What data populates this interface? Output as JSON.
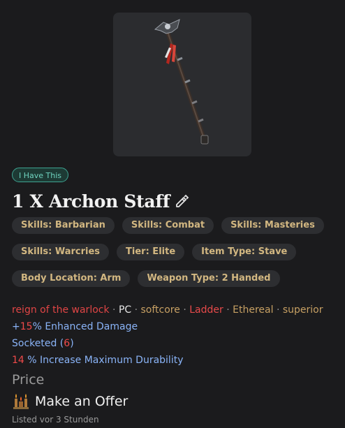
{
  "badge": {
    "label": "I Have This"
  },
  "item": {
    "title": "1 X Archon Staff",
    "image_icon": "archon-staff-icon",
    "edit_icon": "pencil-icon"
  },
  "tags": [
    [
      "Skills: Barbarian",
      "Skills: Combat",
      "Skills: Masteries"
    ],
    [
      "Skills: Warcries",
      "Tier: Elite",
      "Item Type: Stave"
    ],
    [
      "Body Location: Arm",
      "Weapon Type: 2 Handed"
    ]
  ],
  "meta": {
    "season": "reign of the warlock",
    "platform": "PC",
    "mode": "softcore",
    "ladder": "Ladder",
    "ethereal": "Ethereal",
    "quality": "superior",
    "separator": "·"
  },
  "stats": {
    "enhanced_damage_prefix": "+",
    "enhanced_damage_value": "15",
    "enhanced_damage_text": "% Enhanced Damage",
    "socketed_text": "Socketed (",
    "socketed_value": "6",
    "socketed_close": ")",
    "durability_value": "14",
    "durability_text": " % Increase Maximum Durability"
  },
  "price": {
    "label": "Price",
    "offer_label": "Make an Offer",
    "offer_icon": "offer-altar-icon"
  },
  "listed": "Listed vor 3 Stunden",
  "colors": {
    "tag_text": "#d2b781",
    "stat_blue": "#8ab4f8",
    "value_red": "#f04a4a",
    "badge_teal": "#3ea391"
  }
}
